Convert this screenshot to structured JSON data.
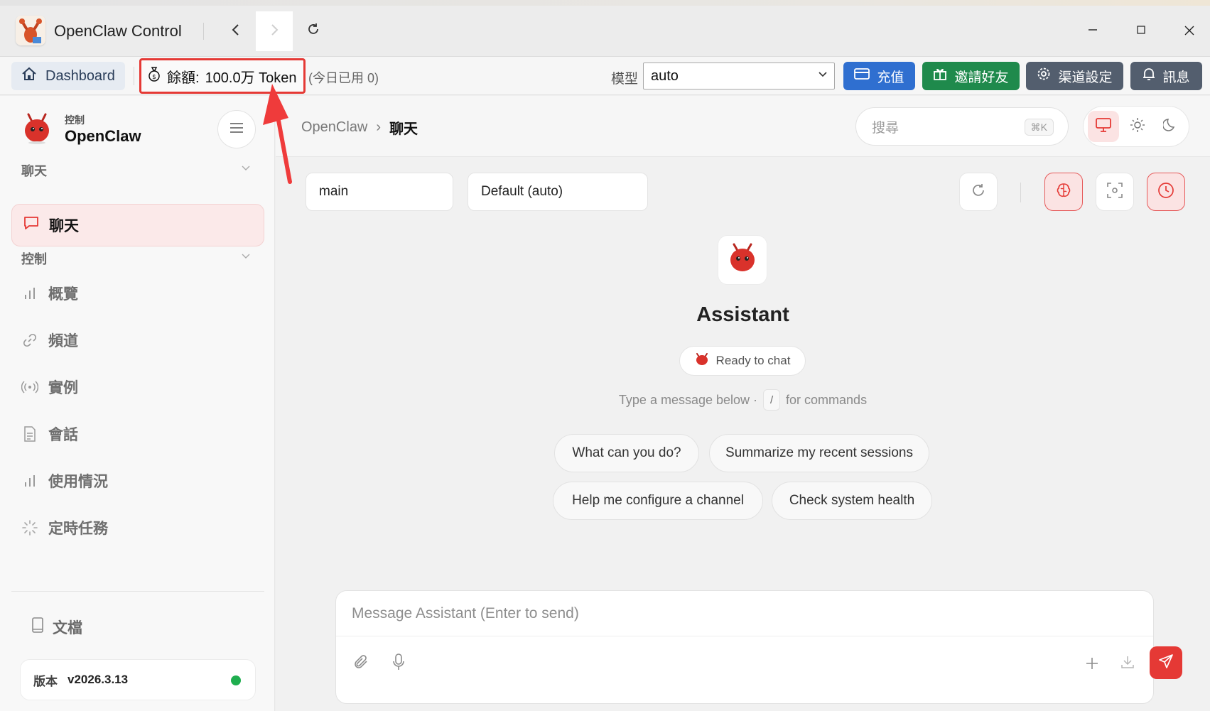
{
  "window": {
    "title": "OpenClaw Control"
  },
  "toolbar": {
    "dashboard_label": "Dashboard",
    "balance_label": "餘額:",
    "balance_value": "100.0万 Token",
    "today_used": "(今日已用 0)",
    "model_label": "模型",
    "model_value": "auto",
    "recharge_label": "充值",
    "invite_label": "邀請好友",
    "channel_settings_label": "渠道設定",
    "messages_label": "訊息",
    "colors": {
      "recharge": "#2f6fd0",
      "invite": "#1f8a4c",
      "channel": "#535e6e",
      "messages": "#535e6e",
      "highlight": "#e53935"
    }
  },
  "sidebar": {
    "brand_sub": "控制",
    "brand_name": "OpenClaw",
    "sections": {
      "chat": "聊天",
      "control": "控制"
    },
    "active_item": "聊天",
    "items": [
      {
        "label": "概覽",
        "icon": "bar-chart-icon"
      },
      {
        "label": "頻道",
        "icon": "link-icon"
      },
      {
        "label": "實例",
        "icon": "broadcast-icon"
      },
      {
        "label": "會話",
        "icon": "document-icon"
      },
      {
        "label": "使用情況",
        "icon": "bar-chart-icon"
      },
      {
        "label": "定時任務",
        "icon": "loader-icon"
      }
    ],
    "docs_label": "文檔",
    "version_label": "版本",
    "version_value": "v2026.3.13",
    "status_color": "#1fae4f"
  },
  "main": {
    "breadcrumb": {
      "root": "OpenClaw",
      "separator": "›",
      "current": "聊天"
    },
    "search": {
      "placeholder": "搜尋",
      "shortcut": "⌘K"
    },
    "session": {
      "name": "main",
      "model": "Default (auto)"
    },
    "assistant": {
      "name": "Assistant",
      "status": "Ready to chat",
      "hint_before": "Type a message below ·",
      "hint_key": "/",
      "hint_after": "for commands"
    },
    "suggestions": [
      "What can you do?",
      "Summarize my recent sessions",
      "Help me configure a channel",
      "Check system health"
    ],
    "composer": {
      "placeholder": "Message Assistant (Enter to send)"
    },
    "accent": "#e53935"
  }
}
